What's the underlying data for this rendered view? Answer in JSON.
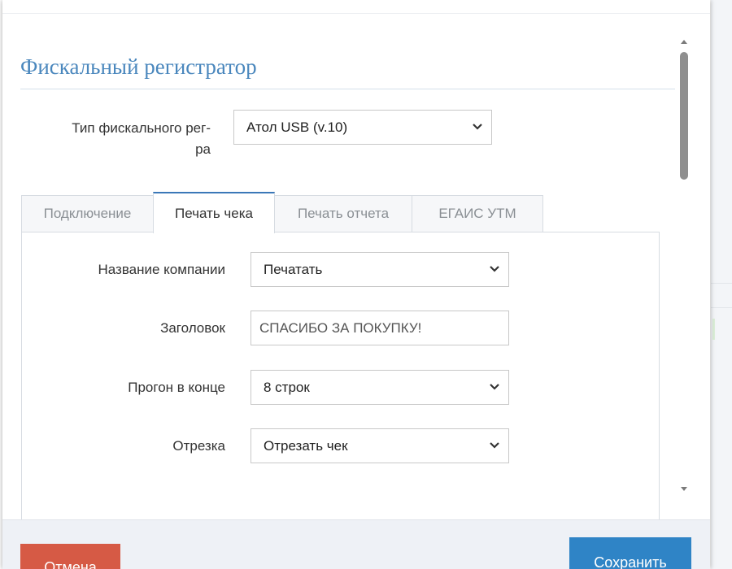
{
  "colors": {
    "accent": "#4a87bd",
    "active_tab": "#3b78b8",
    "cancel": "#d65a45",
    "save": "#2f84c6"
  },
  "section": {
    "title": "Фискальный регистратор"
  },
  "register_type": {
    "label_line1": "Тип фискального рег-",
    "label_line2": "ра",
    "value": "Атол USB (v.10)"
  },
  "tabs": [
    {
      "label": "Подключение",
      "active": false
    },
    {
      "label": "Печать чека",
      "active": true
    },
    {
      "label": "Печать отчета",
      "active": false
    },
    {
      "label": "ЕГАИС УТМ",
      "active": false
    }
  ],
  "receipt_form": {
    "company_name": {
      "label": "Название компании",
      "value": "Печатать"
    },
    "header": {
      "label": "Заголовок",
      "value": "СПАСИБО ЗА ПОКУПКУ!"
    },
    "feed_at_end": {
      "label": "Прогон в конце",
      "value": "8 строк"
    },
    "cut": {
      "label": "Отрезка",
      "value": "Отрезать чек"
    }
  },
  "footer": {
    "cancel_label": "Отмена",
    "save_label": "Сохранить"
  },
  "icons": {
    "select_arrow": "chevron-down-icon",
    "scroll_up": "triangle-up-icon",
    "scroll_down": "triangle-down-icon"
  }
}
